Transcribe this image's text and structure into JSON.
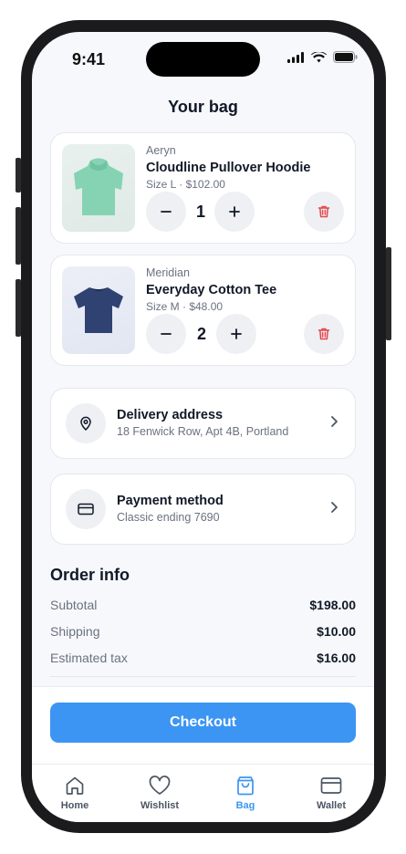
{
  "status_bar": {
    "time": "9:41"
  },
  "header": {
    "title": "Your bag"
  },
  "cart": {
    "items": [
      {
        "brand": "Aeryn",
        "name": "Cloudline Pullover Hoodie",
        "meta": "Size L · $102.00",
        "quantity": "1",
        "color": "#86d3b4"
      },
      {
        "brand": "Meridian",
        "name": "Everyday Cotton Tee",
        "meta": "Size M · $48.00",
        "quantity": "2",
        "color": "#2f4272"
      }
    ]
  },
  "delivery": {
    "title": "Delivery address",
    "value": "18 Fenwick Row, Apt 4B, Portland"
  },
  "payment": {
    "title": "Payment method",
    "value": "Classic ending 7690"
  },
  "order_info": {
    "title": "Order info",
    "rows": [
      {
        "label": "Subtotal",
        "value": "$198.00"
      },
      {
        "label": "Shipping",
        "value": "$10.00"
      },
      {
        "label": "Estimated tax",
        "value": "$16.00"
      }
    ]
  },
  "checkout": {
    "label": "Checkout"
  },
  "tabs": [
    {
      "label": "Home",
      "icon": "home-icon"
    },
    {
      "label": "Wishlist",
      "icon": "heart-icon"
    },
    {
      "label": "Bag",
      "icon": "bag-icon",
      "active": true
    },
    {
      "label": "Wallet",
      "icon": "wallet-icon"
    }
  ],
  "colors": {
    "accent": "#3c95f3",
    "danger": "#e5484d",
    "background": "#f6f8fb"
  }
}
